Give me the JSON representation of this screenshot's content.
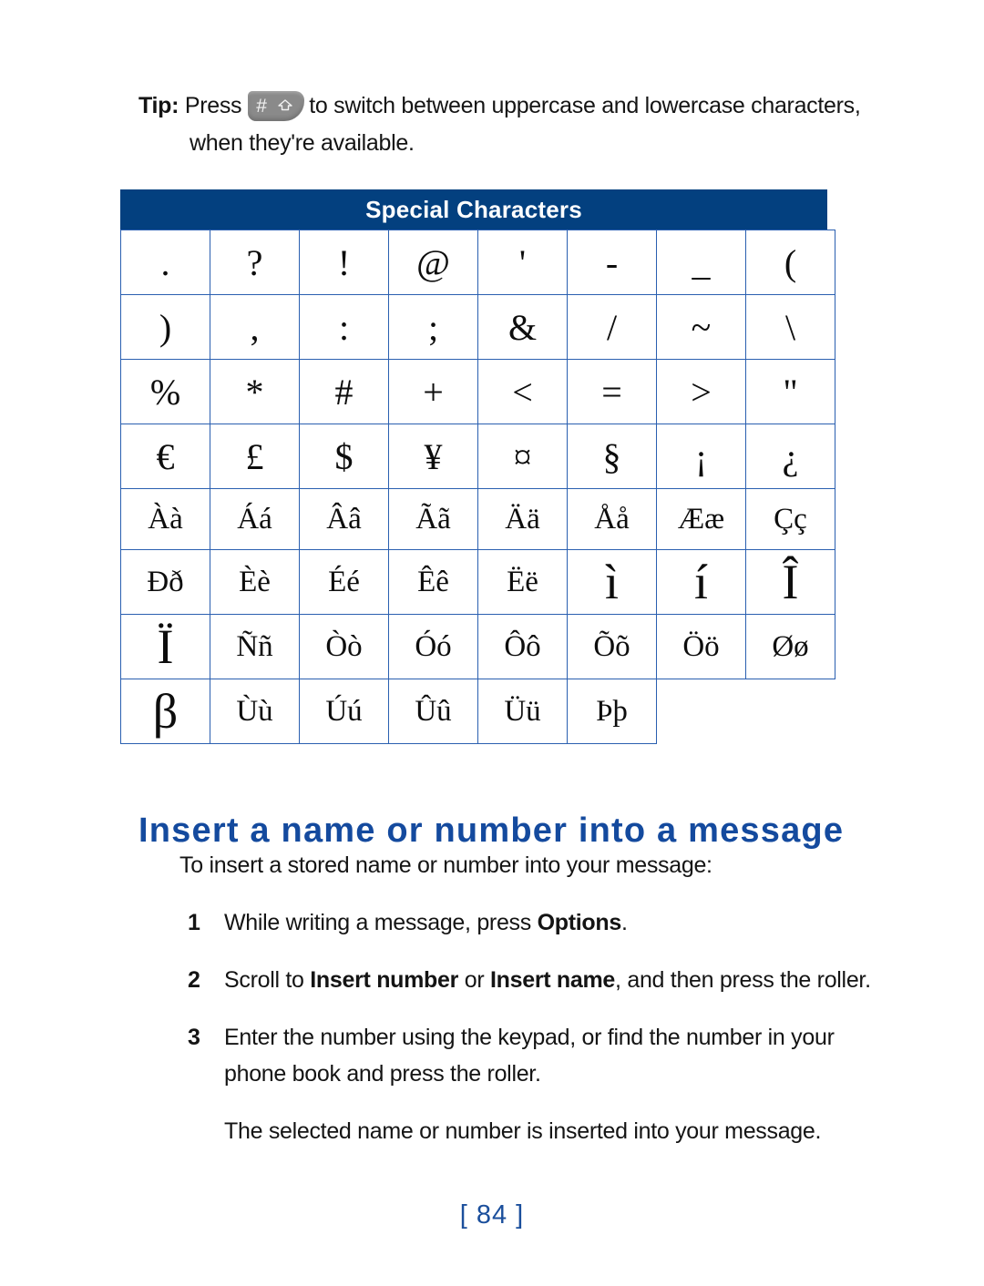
{
  "tip": {
    "label": "Tip:",
    "before_key": "Press",
    "key_icon": {
      "name": "hash-shift-key-icon",
      "hash_glyph": "#",
      "shift_glyph": "shift-arrow"
    },
    "after_key": "to switch between uppercase and lowercase characters,",
    "line2": "when they're available."
  },
  "char_table": {
    "title": "Special Characters",
    "rows": [
      [
        {
          "v": ".",
          "style": "sym"
        },
        {
          "v": "?",
          "style": "sym"
        },
        {
          "v": "!",
          "style": "sym"
        },
        {
          "v": "@",
          "style": "sym"
        },
        {
          "v": "'",
          "style": "sym"
        },
        {
          "v": "-",
          "style": "sym"
        },
        {
          "v": "_",
          "style": "sym"
        },
        {
          "v": "(",
          "style": "sym"
        }
      ],
      [
        {
          "v": ")",
          "style": "sym"
        },
        {
          "v": ",",
          "style": "sym"
        },
        {
          "v": ":",
          "style": "sym"
        },
        {
          "v": ";",
          "style": "sym"
        },
        {
          "v": "&",
          "style": "sym"
        },
        {
          "v": "/",
          "style": "sym"
        },
        {
          "v": "~",
          "style": "sym"
        },
        {
          "v": "\\",
          "style": "sym"
        }
      ],
      [
        {
          "v": "%",
          "style": "sym"
        },
        {
          "v": "*",
          "style": "sym"
        },
        {
          "v": "#",
          "style": "sym"
        },
        {
          "v": "+",
          "style": "sym"
        },
        {
          "v": "<",
          "style": "sym"
        },
        {
          "v": "=",
          "style": "sym"
        },
        {
          "v": ">",
          "style": "sym"
        },
        {
          "v": "\"",
          "style": "sym"
        }
      ],
      [
        {
          "v": "€",
          "style": "sym"
        },
        {
          "v": "£",
          "style": "sym"
        },
        {
          "v": "$",
          "style": "sym"
        },
        {
          "v": "¥",
          "style": "sym"
        },
        {
          "v": "¤",
          "style": "sym"
        },
        {
          "v": "§",
          "style": "sym"
        },
        {
          "v": "¡",
          "style": "sym"
        },
        {
          "v": "¿",
          "style": "sym"
        }
      ],
      [
        {
          "v": "Àà",
          "style": "accent"
        },
        {
          "v": "Áá",
          "style": "accent"
        },
        {
          "v": "Ââ",
          "style": "accent"
        },
        {
          "v": "Ãã",
          "style": "accent"
        },
        {
          "v": "Ää",
          "style": "accent"
        },
        {
          "v": "Åå",
          "style": "accent"
        },
        {
          "v": "Ææ",
          "style": "accent"
        },
        {
          "v": "Çç",
          "style": "accent"
        }
      ],
      [
        {
          "v": "Ðð",
          "style": "accent"
        },
        {
          "v": "Èè",
          "style": "accent"
        },
        {
          "v": "Éé",
          "style": "accent"
        },
        {
          "v": "Êê",
          "style": "accent"
        },
        {
          "v": "Ëë",
          "style": "accent"
        },
        {
          "v": "ì",
          "style": "big"
        },
        {
          "v": "í",
          "style": "big"
        },
        {
          "v": "Î",
          "style": "big"
        }
      ],
      [
        {
          "v": "Ï",
          "style": "big"
        },
        {
          "v": "Ññ",
          "style": "accent"
        },
        {
          "v": "Òò",
          "style": "accent"
        },
        {
          "v": "Óó",
          "style": "accent"
        },
        {
          "v": "Ôô",
          "style": "accent"
        },
        {
          "v": "Õõ",
          "style": "accent"
        },
        {
          "v": "Öö",
          "style": "accent"
        },
        {
          "v": "Øø",
          "style": "accent"
        }
      ],
      [
        {
          "v": "β",
          "style": "big"
        },
        {
          "v": "Ùù",
          "style": "accent"
        },
        {
          "v": "Úú",
          "style": "accent"
        },
        {
          "v": "Ûû",
          "style": "accent"
        },
        {
          "v": "Üü",
          "style": "accent"
        },
        {
          "v": "Þþ",
          "style": "accent"
        },
        {
          "v": "",
          "style": "empty"
        },
        {
          "v": "",
          "style": "empty"
        }
      ]
    ]
  },
  "section": {
    "heading": "Insert a name or number into a message",
    "intro": "To insert a stored name or number into your message:",
    "steps": [
      {
        "num": "1",
        "parts": [
          {
            "t": "While writing a message, press ",
            "bold": false
          },
          {
            "t": "Options",
            "bold": true
          },
          {
            "t": ".",
            "bold": false
          }
        ]
      },
      {
        "num": "2",
        "parts": [
          {
            "t": "Scroll to ",
            "bold": false
          },
          {
            "t": "Insert number",
            "bold": true
          },
          {
            "t": " or ",
            "bold": false
          },
          {
            "t": "Insert name",
            "bold": true
          },
          {
            "t": ", and then press the roller.",
            "bold": false
          }
        ]
      },
      {
        "num": "3",
        "parts": [
          {
            "t": "Enter the number using the keypad, or find the number in your phone book and press the roller.",
            "bold": false
          }
        ]
      }
    ],
    "closing": "The selected name or number is inserted into your message."
  },
  "page_number": "[ 84 ]",
  "colors": {
    "header_blue": "#03407f",
    "grid_blue": "#2a5fb0",
    "heading_blue": "#144a9e",
    "page_number_blue": "#1b4f9c"
  }
}
